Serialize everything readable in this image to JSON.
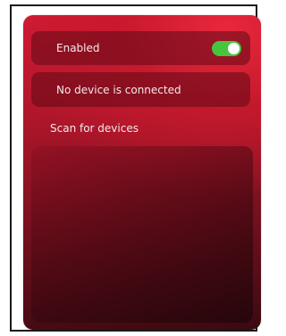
{
  "settings": {
    "enabled_label": "Enabled",
    "enabled_state": true,
    "status_text": "No device is connected",
    "scan_label": "Scan for devices"
  },
  "device_list": {
    "items": []
  },
  "colors": {
    "accent_toggle": "#46c63f",
    "card_primary": "#c81a32",
    "card_dark": "#3b0a12",
    "text": "#f3e9eb"
  }
}
